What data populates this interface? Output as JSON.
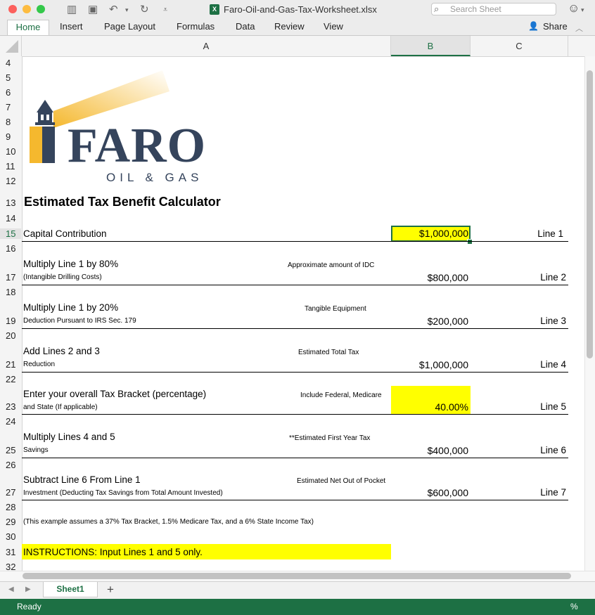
{
  "window": {
    "title": "Faro-Oil-and-Gas-Tax-Worksheet.xlsx",
    "search_placeholder": "Search Sheet",
    "share_label": "Share",
    "icons": [
      "sidebar-icon",
      "save-icon",
      "undo-icon",
      "redo-icon",
      "customize-icon",
      "excel-file-icon",
      "search-icon",
      "smiley-icon"
    ]
  },
  "ribbon": {
    "tabs": [
      "Home",
      "Insert",
      "Page Layout",
      "Formulas",
      "Data",
      "Review",
      "View"
    ],
    "active_tab": "Home"
  },
  "columns": [
    "A",
    "B",
    "C"
  ],
  "rows": [
    "4",
    "5",
    "6",
    "7",
    "8",
    "9",
    "10",
    "11",
    "12",
    "13",
    "14",
    "15",
    "16",
    "17",
    "18",
    "19",
    "20",
    "21",
    "22",
    "23",
    "24",
    "25",
    "26",
    "27",
    "28",
    "29",
    "30",
    "31",
    "32"
  ],
  "logo": {
    "name": "FARO",
    "tagline": "OIL & GAS"
  },
  "sheet": {
    "title": "Estimated Tax Benefit Calculator",
    "line1": {
      "label": "Capital Contribution",
      "value": "$1,000,000",
      "line": "Line 1"
    },
    "line2": {
      "label": "Multiply Line 1 by 80%",
      "sub": "(Intangible Drilling Costs)",
      "note": "Approximate amount of IDC",
      "value": "$800,000",
      "line": "Line 2"
    },
    "line3": {
      "label": "Multiply Line 1 by 20%",
      "sub": "Deduction Pursuant to IRS Sec. 179",
      "note": "Tangible Equipment",
      "value": "$200,000",
      "line": "Line 3"
    },
    "line4": {
      "label": "Add Lines 2 and 3",
      "sub": "Reduction",
      "note": "Estimated Total Tax",
      "value": "$1,000,000",
      "line": "Line 4"
    },
    "line5": {
      "label": "Enter your overall Tax Bracket (percentage)",
      "sub": "and State (If applicable)",
      "note": "Include Federal, Medicare",
      "value": "40.00%",
      "line": "Line 5"
    },
    "line6": {
      "label": "Multiply Lines 4 and 5",
      "sub": "Savings",
      "note": "**Estimated First Year Tax",
      "value": "$400,000",
      "line": "Line 6"
    },
    "line7": {
      "label": "Subtract Line 6 From Line 1",
      "sub": "Investment (Deducting Tax Savings from Total Amount Invested)",
      "note": "Estimated Net Out of Pocket",
      "value": "$600,000",
      "line": "Line 7"
    },
    "example_note": "(This example assumes a 37% Tax Bracket, 1.5% Medicare Tax, and a 6% State Income Tax)",
    "instructions": "INSTRUCTIONS:  Input Lines 1 and 5 only."
  },
  "sheet_tabs": {
    "active": "Sheet1",
    "add_label": "+"
  },
  "status": {
    "left": "Ready",
    "right": "%"
  },
  "colors": {
    "excel_green": "#1d7044",
    "highlight_yellow": "#ffff00",
    "logo_navy": "#35445c",
    "logo_gold": "#f5b82e"
  }
}
